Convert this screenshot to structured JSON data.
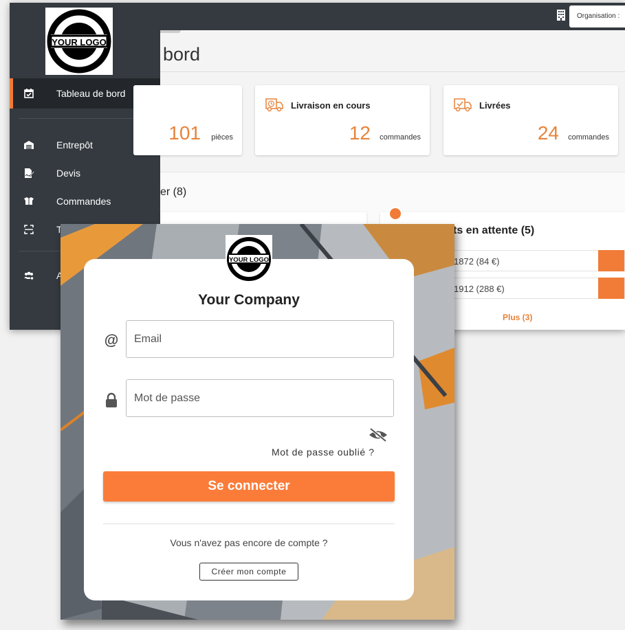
{
  "topbar": {
    "organisation_label": "Organisation :"
  },
  "logo": {
    "text": "YOUR LOGO"
  },
  "sidebar": {
    "items": [
      {
        "label": "Tableau de bord",
        "icon": "calendar-check-icon",
        "active": true
      },
      {
        "label": "Entrepôt",
        "icon": "warehouse-icon"
      },
      {
        "label": "Devis",
        "icon": "file-signature-icon"
      },
      {
        "label": "Commandes",
        "icon": "box-open-icon"
      },
      {
        "label": "T",
        "icon": "scan-icon"
      },
      {
        "label": "A",
        "icon": "users-cog-icon"
      }
    ]
  },
  "main": {
    "title": "bord"
  },
  "cards": [
    {
      "title": "",
      "value": "101",
      "unit": "pièces"
    },
    {
      "title": "Livraison en cours",
      "value": "12",
      "unit": "commandes",
      "icon": "truck-clock-icon"
    },
    {
      "title": "Livrées",
      "value": "24",
      "unit": "commandes",
      "icon": "truck-check-icon"
    }
  ],
  "section": {
    "title": "er (8)",
    "pending_title": "ts en attente (5)",
    "rows": [
      "1872 (84 €)",
      "1912 (288 €)"
    ],
    "more": "Plus (3)"
  },
  "login": {
    "company": "Your Company",
    "email_placeholder": "Email",
    "password_placeholder": "Mot de passe",
    "forgot": "Mot de passe oublié ?",
    "submit": "Se connecter",
    "no_account": "Vous n'avez pas encore de compte ?",
    "create": "Créer mon compte"
  },
  "colors": {
    "accent": "#f07c37",
    "sidebar": "#343a40",
    "sidebar_active": "#23272b"
  }
}
